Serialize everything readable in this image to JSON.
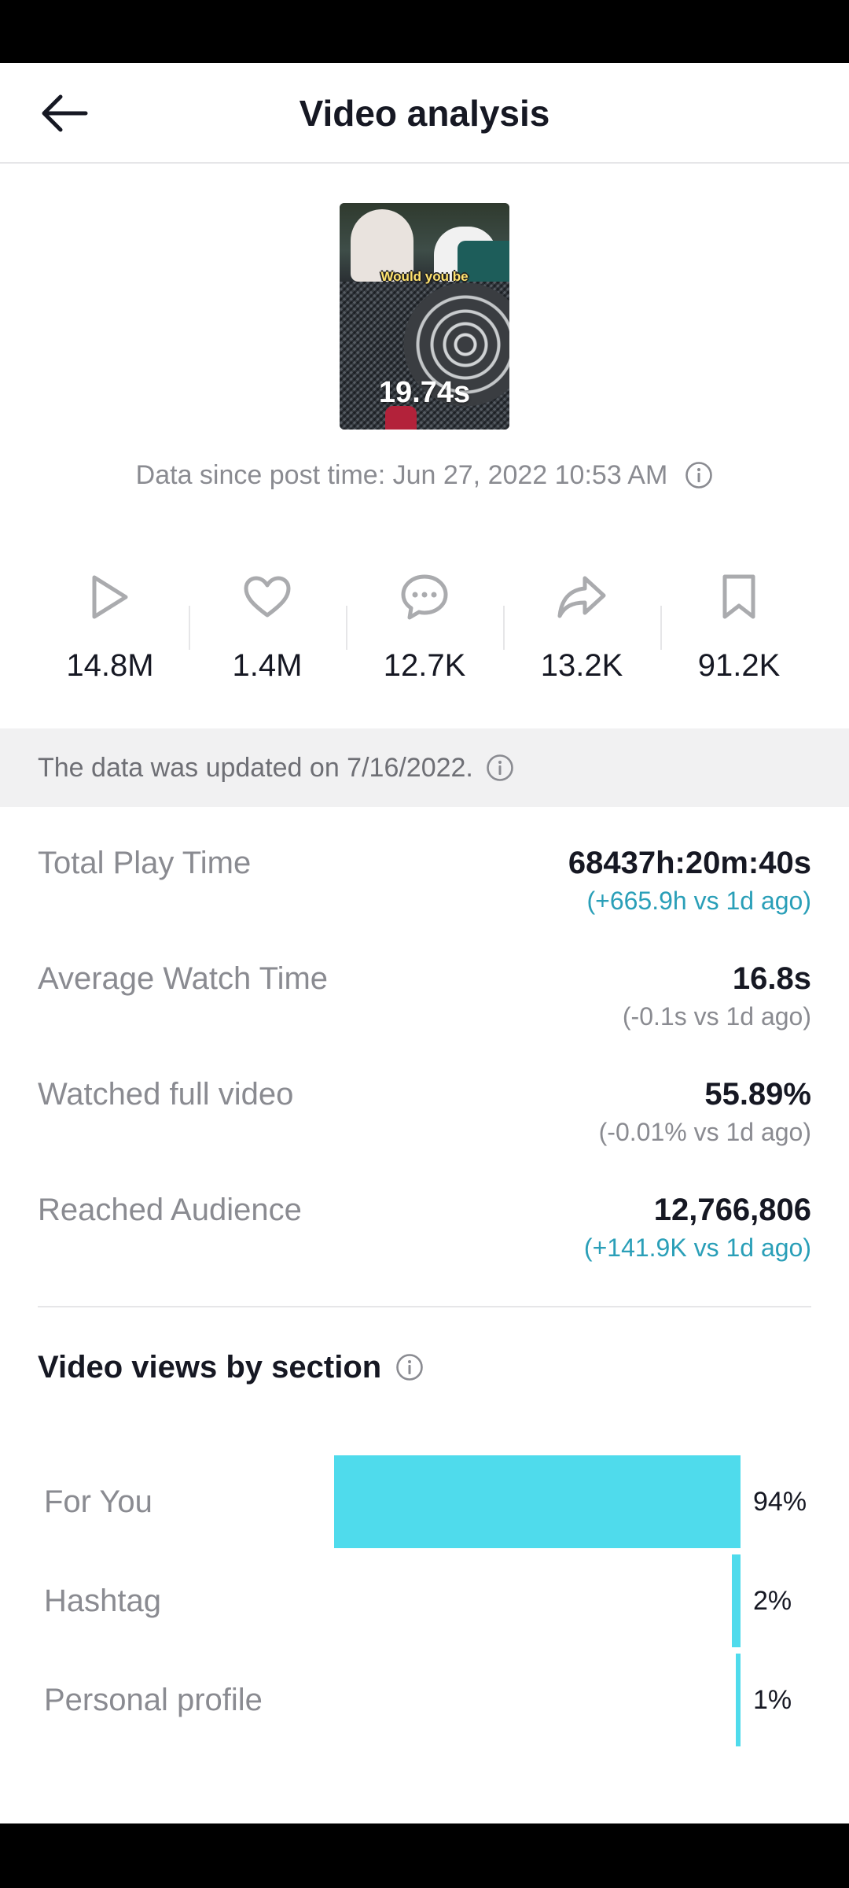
{
  "header": {
    "title": "Video analysis"
  },
  "thumbnail": {
    "caption": "Would you be",
    "duration": "19.74s"
  },
  "data_since": "Data since post time: Jun 27, 2022 10:53 AM",
  "stats": [
    {
      "icon": "play-icon",
      "value": "14.8M"
    },
    {
      "icon": "heart-icon",
      "value": "1.4M"
    },
    {
      "icon": "comment-icon",
      "value": "12.7K"
    },
    {
      "icon": "share-icon",
      "value": "13.2K"
    },
    {
      "icon": "bookmark-icon",
      "value": "91.2K"
    }
  ],
  "updated_banner": "The data was updated on 7/16/2022.",
  "metrics": [
    {
      "label": "Total Play Time",
      "value": "68437h:20m:40s",
      "delta": "(+665.9h vs 1d ago)",
      "delta_type": "up"
    },
    {
      "label": "Average Watch Time",
      "value": "16.8s",
      "delta": "(-0.1s vs 1d ago)",
      "delta_type": "neutral"
    },
    {
      "label": "Watched full video",
      "value": "55.89%",
      "delta": "(-0.01% vs 1d ago)",
      "delta_type": "neutral"
    },
    {
      "label": "Reached Audience",
      "value": "12,766,806",
      "delta": "(+141.9K vs 1d ago)",
      "delta_type": "up"
    }
  ],
  "views_section": {
    "title": "Video views by section"
  },
  "chart_data": {
    "type": "bar",
    "orientation": "horizontal",
    "categories": [
      "For You",
      "Hashtag",
      "Personal profile"
    ],
    "values": [
      94,
      2,
      1
    ],
    "value_labels": [
      "94%",
      "2%",
      "1%"
    ],
    "unit": "%",
    "bar_color": "#4fdbec"
  },
  "colors": {
    "accent": "#4fdbec",
    "delta_up": "#2a9fb8",
    "muted": "#8a8b91",
    "text": "#161823"
  }
}
